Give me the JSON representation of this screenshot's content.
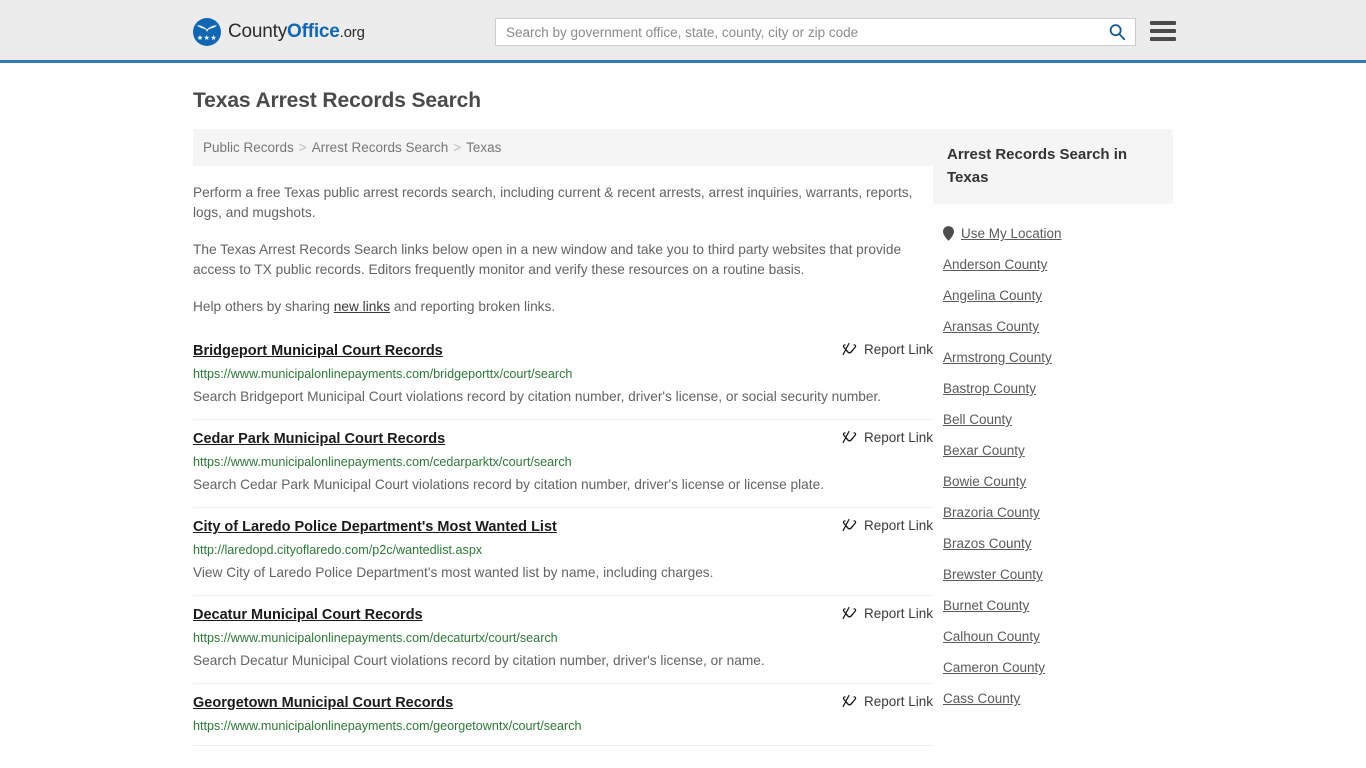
{
  "header": {
    "brand": {
      "part1": "County",
      "part2": "Office",
      "part3": ".org",
      "icon": "eagle-seal-icon",
      "stars": "★★★"
    },
    "search": {
      "placeholder": "Search by government office, state, county, city or zip code",
      "value": "",
      "icon": "search-icon"
    },
    "menu_icon": "hamburger-menu-icon",
    "accent_color": "#3579b0",
    "background_color": "#ececec"
  },
  "page": {
    "title": "Texas Arrest Records Search"
  },
  "breadcrumb": {
    "items": [
      "Public Records",
      "Arrest Records Search",
      "Texas"
    ],
    "separator": ">"
  },
  "intro": {
    "paragraph1": "Perform a free Texas public arrest records search, including current & recent arrests, arrest inquiries, warrants, reports, logs, and mugshots.",
    "paragraph2": "The Texas Arrest Records Search links below open in a new window and take you to third party websites that provide access to TX public records. Editors frequently monitor and verify these resources on a routine basis.",
    "paragraph3_pre": "Help others by sharing ",
    "paragraph3_link": "new links",
    "paragraph3_post": " and reporting broken links."
  },
  "results": {
    "report_label": "Report Link",
    "report_icon": "broken-link-icon",
    "url_color": "#2d7a37",
    "items": [
      {
        "title": "Bridgeport Municipal Court Records",
        "url": "https://www.municipalonlinepayments.com/bridgeporttx/court/search",
        "description": "Search Bridgeport Municipal Court violations record by citation number, driver's license, or social security number."
      },
      {
        "title": "Cedar Park Municipal Court Records",
        "url": "https://www.municipalonlinepayments.com/cedarparktx/court/search",
        "description": "Search Cedar Park Municipal Court violations record by citation number, driver's license or license plate."
      },
      {
        "title": "City of Laredo Police Department's Most Wanted List",
        "url": "http://laredopd.cityoflaredo.com/p2c/wantedlist.aspx",
        "description": "View City of Laredo Police Department's most wanted list by name, including charges."
      },
      {
        "title": "Decatur Municipal Court Records",
        "url": "https://www.municipalonlinepayments.com/decaturtx/court/search",
        "description": "Search Decatur Municipal Court violations record by citation number, driver's license, or name."
      },
      {
        "title": "Georgetown Municipal Court Records",
        "url": "https://www.municipalonlinepayments.com/georgetowntx/court/search",
        "description": ""
      }
    ]
  },
  "sidebar": {
    "heading": "Arrest Records Search in Texas",
    "use_my_location": {
      "label": "Use My Location",
      "icon": "map-pin-icon"
    },
    "counties": [
      "Anderson County",
      "Angelina County",
      "Aransas County",
      "Armstrong County",
      "Bastrop County",
      "Bell County",
      "Bexar County",
      "Bowie County",
      "Brazoria County",
      "Brazos County",
      "Brewster County",
      "Burnet County",
      "Calhoun County",
      "Cameron County",
      "Cass County"
    ]
  }
}
